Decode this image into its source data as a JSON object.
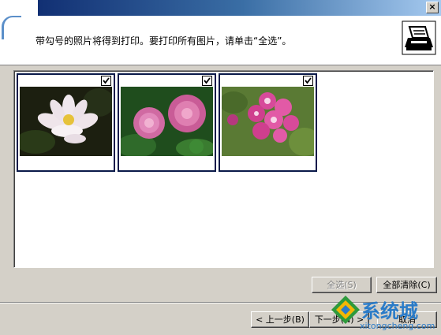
{
  "window": {
    "close_label": "×"
  },
  "header": {
    "instruction": "带勾号的照片将得到打印。要打印所有图片，请单击“全选”。",
    "printer_icon": "printer-icon"
  },
  "photos": [
    {
      "name": "lotus",
      "checked": true
    },
    {
      "name": "pink-flowers",
      "checked": true
    },
    {
      "name": "geranium",
      "checked": true
    }
  ],
  "selection_buttons": {
    "select_all": "全选(S)",
    "clear_all": "全部清除(C)"
  },
  "nav_buttons": {
    "back": "< 上一步(B)",
    "next": "下一步(N) >",
    "cancel": "取消"
  },
  "watermark": {
    "title": "系统城",
    "url": "xitongcheng.com"
  }
}
